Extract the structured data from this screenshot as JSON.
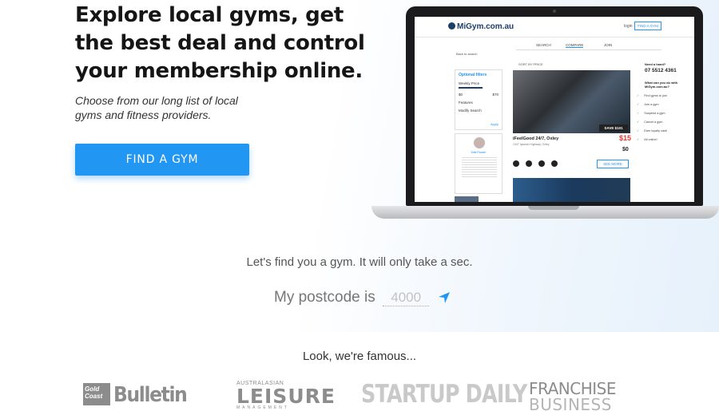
{
  "hero": {
    "title": "Explore local gyms, get the best deal and control your membership online.",
    "subtitle": "Choose from our long list of local gyms and fitness providers.",
    "cta_label": "FIND A GYM"
  },
  "screen": {
    "logo": "MiGym.com.au",
    "login": "login",
    "find_button": "FIND A GYM",
    "tabs": [
      "SEARCH",
      "COMPARE",
      "JOIN"
    ],
    "back": "Back to search",
    "sort": "SORT BY PRICE",
    "filters": {
      "title": "Optional filters",
      "rows": [
        "Weekly Price",
        "Features",
        "Modify Search"
      ],
      "min": "$0",
      "max": "$70",
      "apply": "Apply"
    },
    "profile_name": "Matt Rowan",
    "listing": {
      "save_badge": "SAVE $101",
      "name": "iFeelGood 24/7, Oxley",
      "address": "1347 Ipswich Highway, Oxley",
      "price_main": "$15",
      "price_second": "$0",
      "see_more": "SEE MORE"
    },
    "sidebar": {
      "need": "Need a hand?",
      "phone": "07 5512 4361",
      "what": "What can you do with MiGym.com.au?",
      "bullets": [
        "Find gyms to join",
        "Join a gym",
        "Suspend a gym",
        "Cancel a gym",
        "Earn loyalty cash",
        "All online!"
      ]
    }
  },
  "search": {
    "tagline": "Let's find you a gym. It will only take a sec.",
    "postcode_label": "My postcode is",
    "postcode_placeholder": "4000",
    "locate_icon": "location-arrow-icon"
  },
  "press": {
    "heading": "Look, we're famous...",
    "gcb_small": "Gold Coast",
    "gcb_big": "Bulletin",
    "leisure_small": "AUSTRALASIAN",
    "leisure_big": "LEISURE",
    "leisure_mgmt": "MANAGEMENT",
    "startup": "STARTUP DAILY",
    "franchise_top": "FRANCHISE",
    "franchise_bottom": "BUSINESS"
  },
  "colors": {
    "accent": "#2196f3",
    "title": "#151515",
    "logo_grey": "#8c8c8c"
  }
}
